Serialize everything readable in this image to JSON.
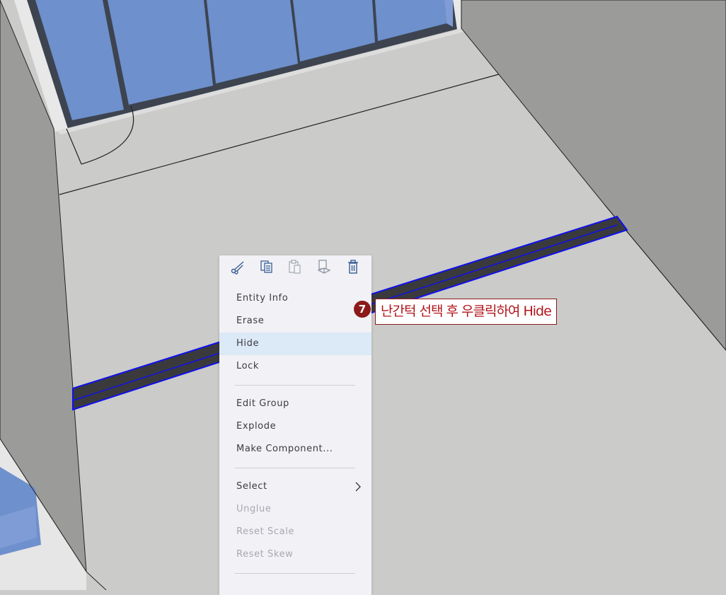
{
  "viewport": {
    "floor_color": "#cbcbc9",
    "wall_color": "#9b9b9a",
    "glass_color": "#6e90cc",
    "selection_color": "#1010ee",
    "selected_object": "railing-bar"
  },
  "context_menu": {
    "toolbar": [
      {
        "icon": "cut-icon"
      },
      {
        "icon": "copy-icon"
      },
      {
        "icon": "paste-icon"
      },
      {
        "icon": "paste-in-place-icon"
      },
      {
        "icon": "delete-icon"
      }
    ],
    "items": [
      {
        "label": "Entity Info",
        "state": "normal"
      },
      {
        "label": "Erase",
        "state": "normal"
      },
      {
        "label": "Hide",
        "state": "highlighted"
      },
      {
        "label": "Lock",
        "state": "normal"
      },
      {
        "label": "Edit Group",
        "state": "normal"
      },
      {
        "label": "Explode",
        "state": "normal"
      },
      {
        "label": "Make Component...",
        "state": "normal"
      },
      {
        "label": "Select",
        "state": "normal",
        "submenu": true
      },
      {
        "label": "Unglue",
        "state": "disabled"
      },
      {
        "label": "Reset Scale",
        "state": "disabled"
      },
      {
        "label": "Reset Skew",
        "state": "disabled"
      }
    ]
  },
  "callout": {
    "number": "7",
    "text": "난간턱 선택 후 우클릭하여 Hide",
    "color": "#8c1a1a"
  }
}
